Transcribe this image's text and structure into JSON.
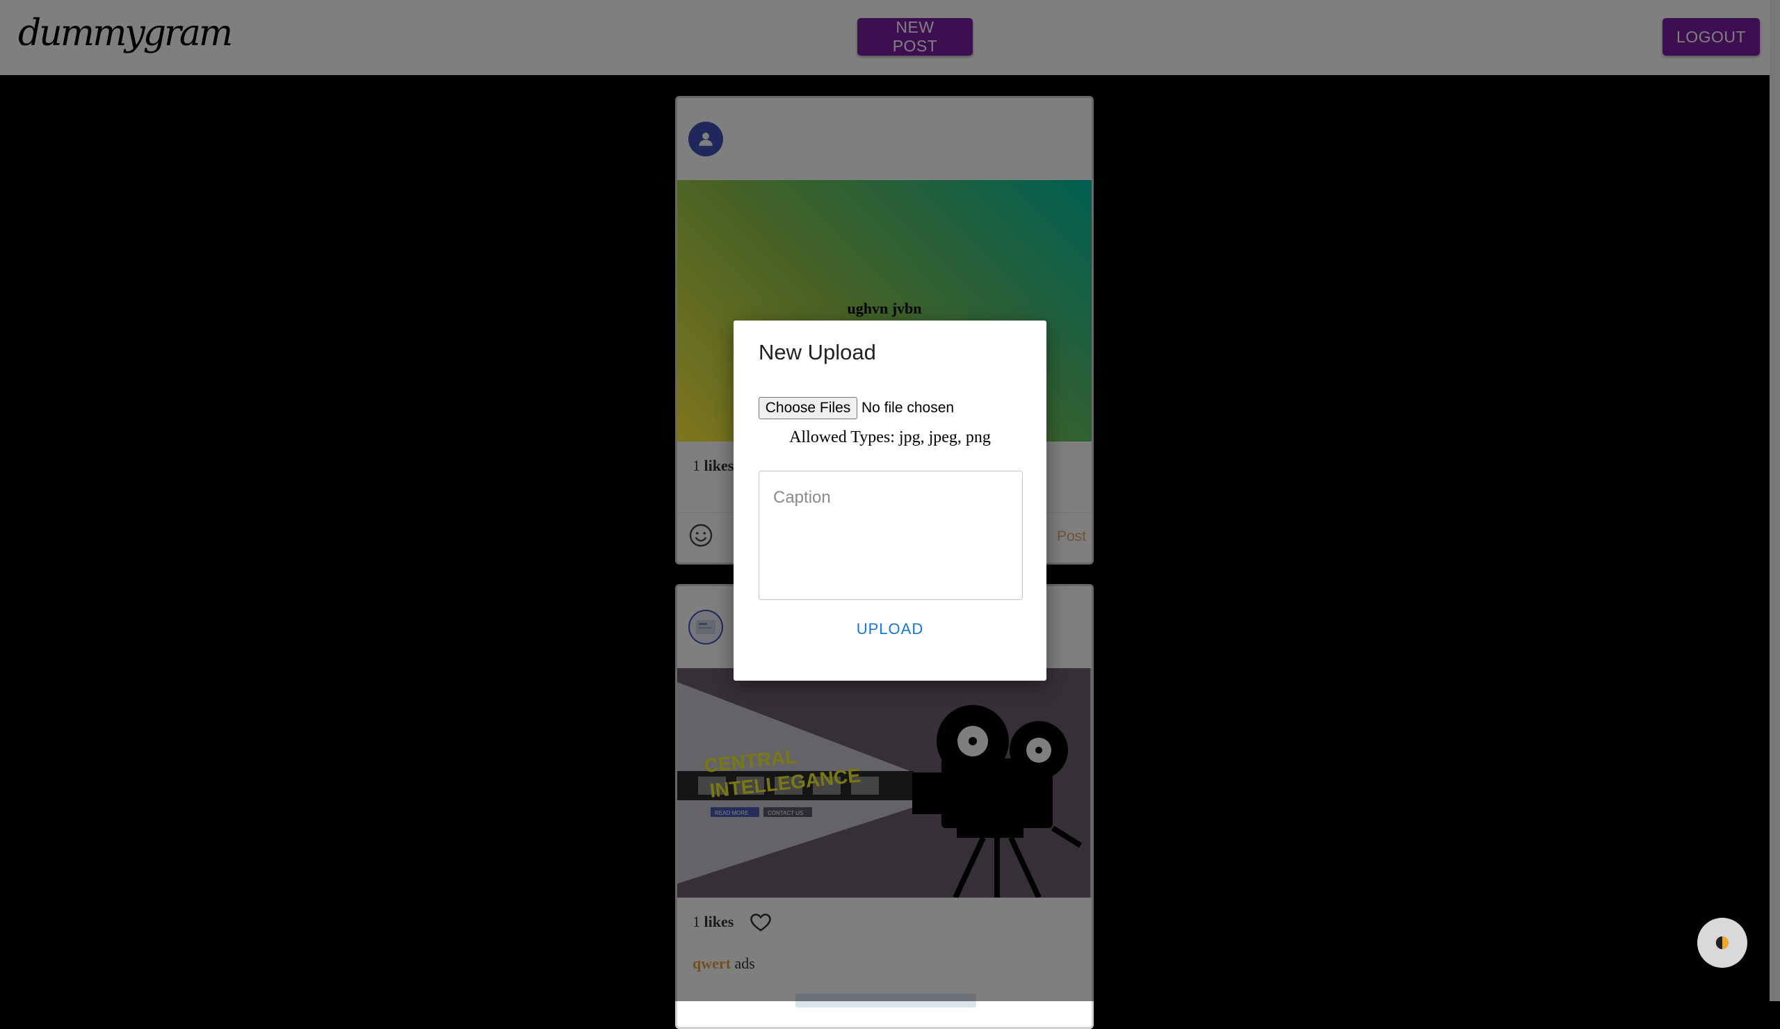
{
  "header": {
    "logo": "dummygram",
    "new_post_label": "NEW POST",
    "logout_label": "LOGOUT"
  },
  "feed": {
    "posts": [
      {
        "image_text": "ughvn jvbn",
        "likes_count": "1",
        "likes_label": "likes",
        "post_label": "Post"
      },
      {
        "image_texts": [
          "CENTRAL",
          "INTELLEGANCE",
          "READ MORE",
          "CONTACT US"
        ],
        "likes_count": "1",
        "likes_label": "likes",
        "username": "qwert",
        "caption": "ads"
      }
    ]
  },
  "modal": {
    "title": "New Upload",
    "choose_files_label": "Choose Files",
    "file_status": "No file chosen",
    "allowed_types": "Allowed Types: jpg, jpeg, png",
    "caption_placeholder": "Caption",
    "upload_label": "UPLOAD"
  },
  "colors": {
    "accent": "#7b1fa2",
    "upload_link": "#1976d2",
    "username": "#e0a040"
  },
  "icons": [
    "user-icon",
    "emoji-icon",
    "heart-icon",
    "theme-toggle-icon"
  ]
}
